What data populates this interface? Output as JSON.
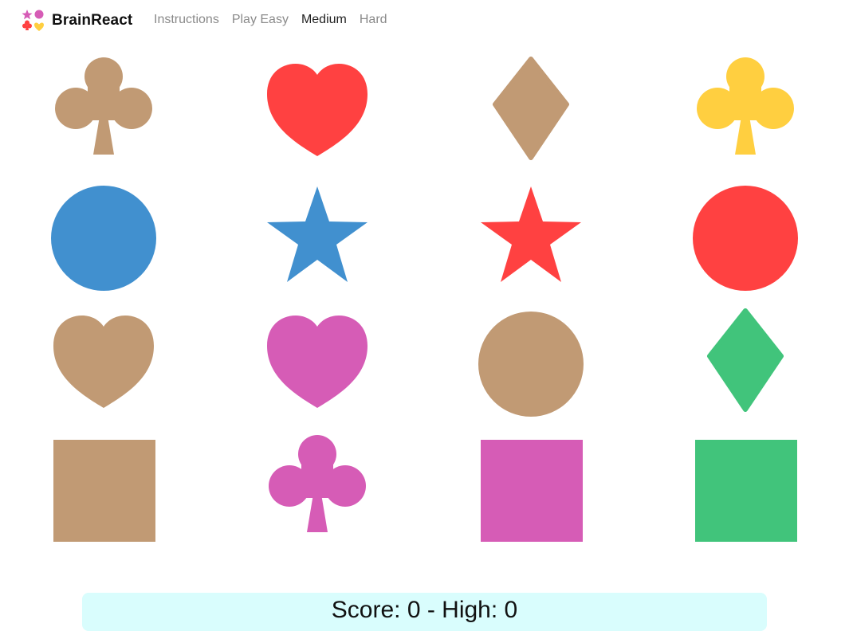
{
  "app": {
    "brand": "BrainReact"
  },
  "nav": {
    "items": [
      {
        "label": "Instructions",
        "active": false
      },
      {
        "label": "Play Easy",
        "active": false
      },
      {
        "label": "Medium",
        "active": true
      },
      {
        "label": "Hard",
        "active": false
      }
    ]
  },
  "colors": {
    "tan": "#c19a74",
    "red": "#ff4141",
    "yellow": "#ffcf40",
    "blue": "#4190cf",
    "magenta": "#d65cb6",
    "green": "#41c47b",
    "score_bg": "#d9fdfd"
  },
  "board": {
    "rows": 4,
    "cols": 4,
    "cards": [
      {
        "shape": "club",
        "color": "tan"
      },
      {
        "shape": "heart",
        "color": "red"
      },
      {
        "shape": "diamond",
        "color": "tan"
      },
      {
        "shape": "club",
        "color": "yellow"
      },
      {
        "shape": "circle",
        "color": "blue"
      },
      {
        "shape": "star",
        "color": "blue"
      },
      {
        "shape": "star",
        "color": "red"
      },
      {
        "shape": "circle",
        "color": "red"
      },
      {
        "shape": "heart",
        "color": "tan"
      },
      {
        "shape": "heart",
        "color": "magenta"
      },
      {
        "shape": "circle",
        "color": "tan"
      },
      {
        "shape": "diamond",
        "color": "green"
      },
      {
        "shape": "square",
        "color": "tan"
      },
      {
        "shape": "club",
        "color": "magenta"
      },
      {
        "shape": "square",
        "color": "magenta"
      },
      {
        "shape": "square",
        "color": "green"
      }
    ]
  },
  "score": {
    "text": "Score: 0 - High: 0"
  }
}
